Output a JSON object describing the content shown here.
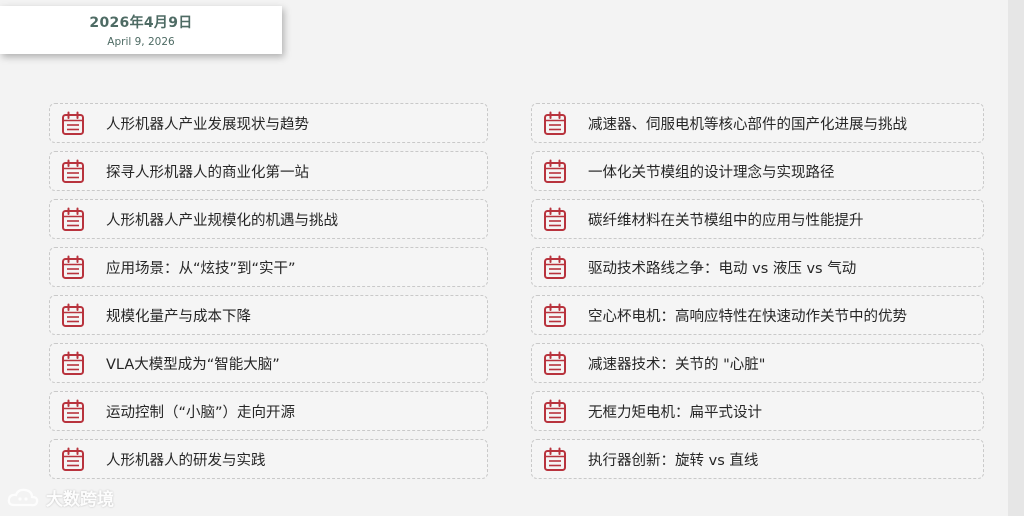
{
  "date": {
    "main": "2026年4月9日",
    "sub": "April 9, 2026"
  },
  "colors": {
    "accent": "#b8333d",
    "date_text": "#4e6b64"
  },
  "icon": "calendar-list-icon",
  "left_items": [
    "人形机器人产业发展现状与趋势",
    "探寻人形机器人的商业化第一站",
    "人形机器人产业规模化的机遇与挑战",
    "应用场景：从“炫技”到“实干”",
    "规模化量产与成本下降",
    "VLA大模型成为“智能大脑”",
    "运动控制（“小脑”）走向开源",
    "人形机器人的研发与实践"
  ],
  "right_items": [
    "减速器、伺服电机等核心部件的国产化进展与挑战",
    "一体化关节模组的设计理念与实现路径",
    "碳纤维材料在关节模组中的应用与性能提升",
    "驱动技术路线之争：电动 vs 液压 vs 气动",
    "空心杯电机：高响应特性在快速动作关节中的优势",
    "减速器技术：关节的 \"心脏\"",
    "无框力矩电机：扁平式设计",
    "执行器创新：旋转 vs 直线"
  ],
  "watermark": "大数跨境"
}
